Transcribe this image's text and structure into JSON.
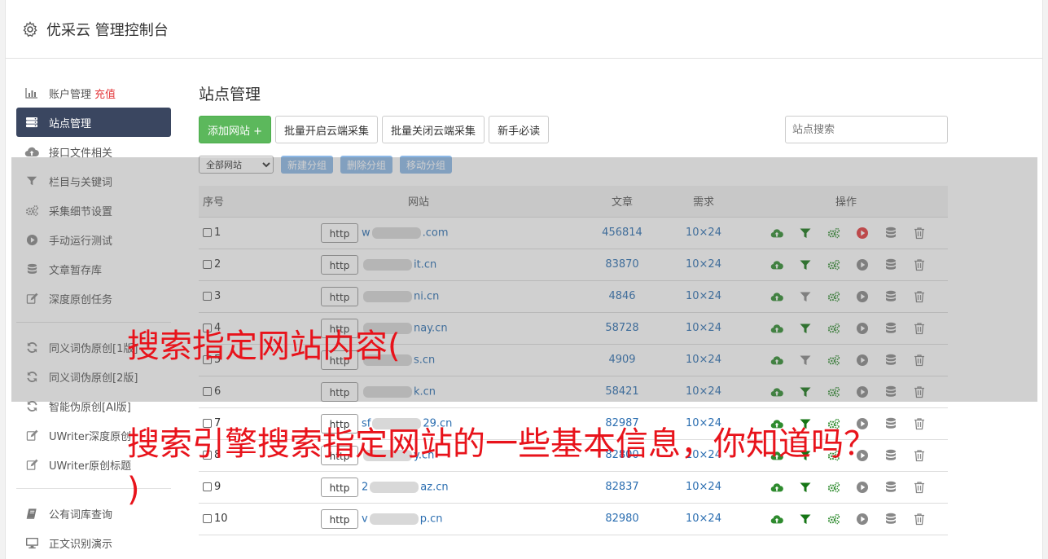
{
  "app": {
    "title": "优采云 管理控制台"
  },
  "sidebar": {
    "group1": [
      {
        "label": "账户管理",
        "icon": "bar-chart-icon",
        "extra": "充值"
      },
      {
        "label": "站点管理",
        "icon": "server-list-icon",
        "active": true
      },
      {
        "label": "接口文件相关",
        "icon": "cloud-upload-icon"
      },
      {
        "label": "栏目与关键词",
        "icon": "filter-icon"
      },
      {
        "label": "采集细节设置",
        "icon": "gears-icon"
      },
      {
        "label": "手动运行测试",
        "icon": "play-icon"
      },
      {
        "label": "文章暂存库",
        "icon": "database-icon"
      },
      {
        "label": "深度原创任务",
        "icon": "edit-icon"
      }
    ],
    "group2": [
      {
        "label": "同义词伪原创[1版]",
        "icon": "refresh-icon"
      },
      {
        "label": "同义词伪原创[2版]",
        "icon": "refresh-icon"
      },
      {
        "label": "智能伪原创[AI版]",
        "icon": "refresh-icon"
      },
      {
        "label": "UWriter深度原创",
        "icon": "edit-icon"
      },
      {
        "label": "UWriter原创标题",
        "icon": "edit-icon"
      }
    ],
    "group3": [
      {
        "label": "公有词库查询",
        "icon": "book-icon"
      },
      {
        "label": "正文识别演示",
        "icon": "monitor-icon"
      }
    ]
  },
  "main": {
    "title": "站点管理",
    "buttons": {
      "add": "添加网站 +",
      "batch_open": "批量开启云端采集",
      "batch_close": "批量关闭云端采集",
      "guide": "新手必读"
    },
    "search_placeholder": "站点搜索",
    "group_select": "全部网站",
    "group_buttons": {
      "new": "新建分组",
      "delete": "删除分组",
      "move": "移动分组"
    },
    "table": {
      "headers": {
        "no": "序号",
        "site": "网站",
        "articles": "文章",
        "demand": "需求",
        "ops": "操作"
      },
      "rows": [
        {
          "no": "1",
          "proto": "http",
          "pre": "w",
          "post": ".com",
          "articles": "456814",
          "demand": "10×24",
          "run_active": true,
          "filter_active": true
        },
        {
          "no": "2",
          "proto": "http",
          "pre": "",
          "post": "it.cn",
          "articles": "83870",
          "demand": "10×24",
          "run_active": false,
          "filter_active": true
        },
        {
          "no": "3",
          "proto": "http",
          "pre": "",
          "post": "ni.cn",
          "articles": "4846",
          "demand": "10×24",
          "run_active": false,
          "filter_active": false
        },
        {
          "no": "4",
          "proto": "http",
          "pre": "",
          "post": "nay.cn",
          "articles": "58728",
          "demand": "10×24",
          "run_active": false,
          "filter_active": true
        },
        {
          "no": "5",
          "proto": "http",
          "pre": "",
          "post": "s.cn",
          "articles": "4909",
          "demand": "10×24",
          "run_active": false,
          "filter_active": false
        },
        {
          "no": "6",
          "proto": "http",
          "pre": "",
          "post": "k.cn",
          "articles": "58421",
          "demand": "10×24",
          "run_active": false,
          "filter_active": true
        },
        {
          "no": "7",
          "proto": "http",
          "pre": "sf",
          "post": "29.cn",
          "articles": "82987",
          "demand": "10×24",
          "run_active": false,
          "filter_active": true
        },
        {
          "no": "8",
          "proto": "http",
          "pre": "",
          "post": "y.cn",
          "articles": "82800",
          "demand": "10×24",
          "run_active": false,
          "filter_active": true
        },
        {
          "no": "9",
          "proto": "http",
          "pre": "2",
          "post": "az.cn",
          "articles": "82837",
          "demand": "10×24",
          "run_active": false,
          "filter_active": true
        },
        {
          "no": "10",
          "proto": "http",
          "pre": "v",
          "post": "p.cn",
          "articles": "82980",
          "demand": "10×24",
          "run_active": false,
          "filter_active": true
        }
      ]
    }
  },
  "captions": {
    "line1": "搜索指定网站内容(",
    "line2": "搜索引擎搜索指定网站的一些基本信息，你知道吗？",
    "line3": ")"
  },
  "colors": {
    "green": "#5cb85c",
    "sidebar_active": "#3a4660",
    "link": "#2a6db0",
    "caption": "#e8131b",
    "run_active": "#e4393c"
  }
}
